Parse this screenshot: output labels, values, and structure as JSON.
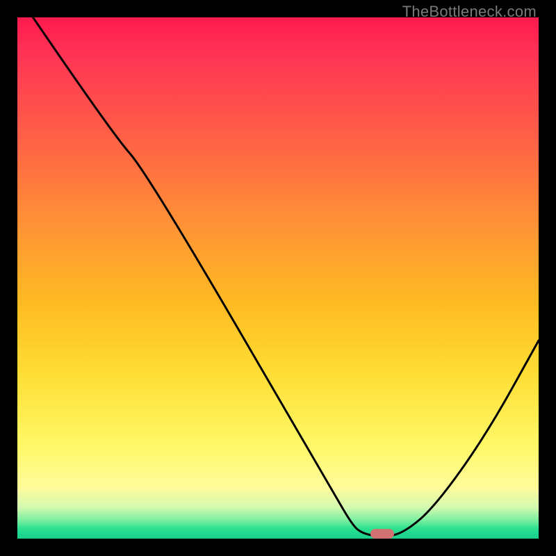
{
  "watermark": "TheBottleneck.com",
  "chart_data": {
    "type": "line",
    "title": "",
    "xlabel": "",
    "ylabel": "",
    "xlim": [
      0,
      100
    ],
    "ylim": [
      0,
      100
    ],
    "curve": [
      {
        "x": 3,
        "y": 100
      },
      {
        "x": 18,
        "y": 78
      },
      {
        "x": 25,
        "y": 70
      },
      {
        "x": 60,
        "y": 10
      },
      {
        "x": 64,
        "y": 3
      },
      {
        "x": 66,
        "y": 1
      },
      {
        "x": 70,
        "y": 0.3
      },
      {
        "x": 74,
        "y": 1
      },
      {
        "x": 80,
        "y": 6
      },
      {
        "x": 90,
        "y": 20
      },
      {
        "x": 100,
        "y": 38
      }
    ],
    "marker": {
      "x": 70,
      "y": 0.9
    },
    "gradient_stops": [
      {
        "pos": 0,
        "color": "#ff1a4d"
      },
      {
        "pos": 25,
        "color": "#ff6644"
      },
      {
        "pos": 55,
        "color": "#ffbb22"
      },
      {
        "pos": 82,
        "color": "#fff866"
      },
      {
        "pos": 96.5,
        "color": "#7aeea0"
      },
      {
        "pos": 100,
        "color": "#1ace8a"
      }
    ]
  }
}
